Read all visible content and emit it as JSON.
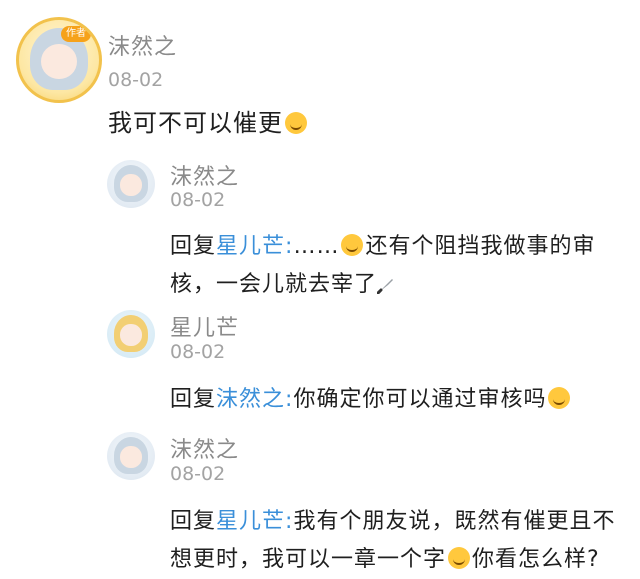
{
  "main_post": {
    "author": "沫然之",
    "date": "08-02",
    "badge": "作者",
    "text": "我可不可以催更",
    "emoji": "smirk-emoji"
  },
  "replies": [
    {
      "author": "沫然之",
      "date": "08-02",
      "prefix": "回复",
      "target": "星儿芒",
      "sep": ":",
      "text1": "……",
      "emoji1": "laugh-cry-emoji",
      "text2": "还有个阻挡我做事的审",
      "text3": "核，一会儿就去宰了",
      "icon": "knife-icon"
    },
    {
      "author": "星儿芒",
      "date": "08-02",
      "prefix": "回复",
      "target": "沫然之",
      "sep": ":",
      "text1": "你确定你可以通过审核吗",
      "emoji1": "laugh-cry-emoji"
    },
    {
      "author": "沫然之",
      "date": "08-02",
      "prefix": "回复",
      "target": "星儿芒",
      "sep": ":",
      "text1": "我有个朋友说，既然有催更且不",
      "text2": "想更时，我可以一章一个字",
      "emoji1": "smirk-emoji",
      "text3": "你看怎么样?"
    }
  ]
}
